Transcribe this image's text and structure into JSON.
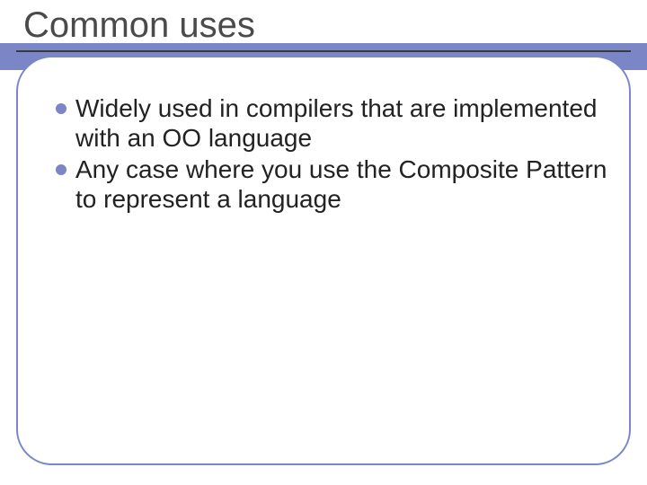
{
  "title": "Common uses",
  "bullets": [
    "Widely used in compilers that are implemented with an OO language",
    "Any case where you use the Composite Pattern  to represent a language"
  ],
  "colors": {
    "accent": "#7b86c6",
    "text": "#222222",
    "title": "#4a4a4a"
  }
}
